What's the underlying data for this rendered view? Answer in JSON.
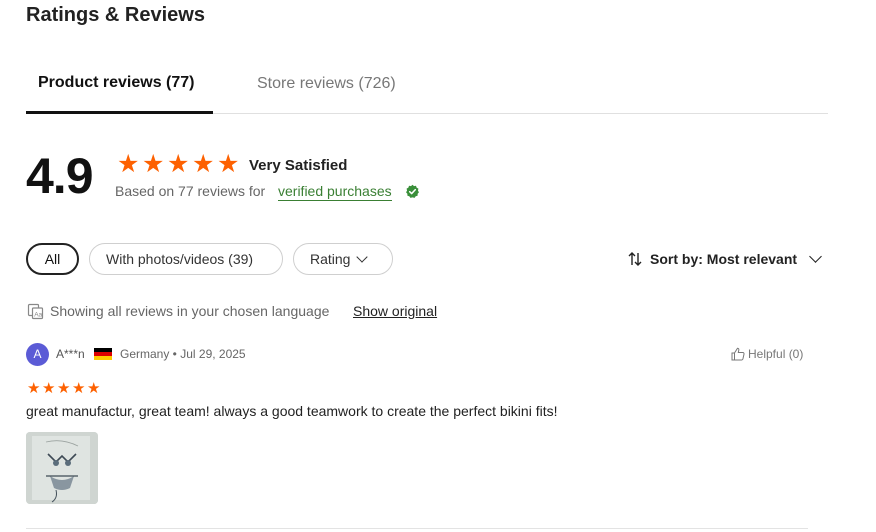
{
  "section": {
    "title": "Ratings & Reviews"
  },
  "tabs": [
    {
      "label": "Product reviews (77)"
    },
    {
      "label": "Store reviews (726)"
    }
  ],
  "summary": {
    "score": "4.9",
    "rating_stars": 5,
    "rating_label": "Very Satisfied",
    "based_on": "Based on 77 reviews for",
    "verified_link": "verified purchases"
  },
  "filters": {
    "all": "All",
    "photos": "With photos/videos (39)",
    "rating": "Rating"
  },
  "sort": {
    "label": "Sort by: Most relevant"
  },
  "language": {
    "note": "Showing all reviews in your chosen language",
    "show_original": "Show original"
  },
  "review": {
    "avatar_letter": "A",
    "reviewer": "A***n",
    "country_flag": "germany-flag",
    "meta": "Germany • Jul 29, 2025",
    "helpful": "Helpful (0)",
    "rating_stars": 5,
    "text": "great manufactur, great team! always a good teamwork to create the perfect bikini fits!"
  },
  "colors": {
    "star": "#fd6101",
    "verified": "#3a7f33",
    "avatar": "#5b5bd6"
  }
}
